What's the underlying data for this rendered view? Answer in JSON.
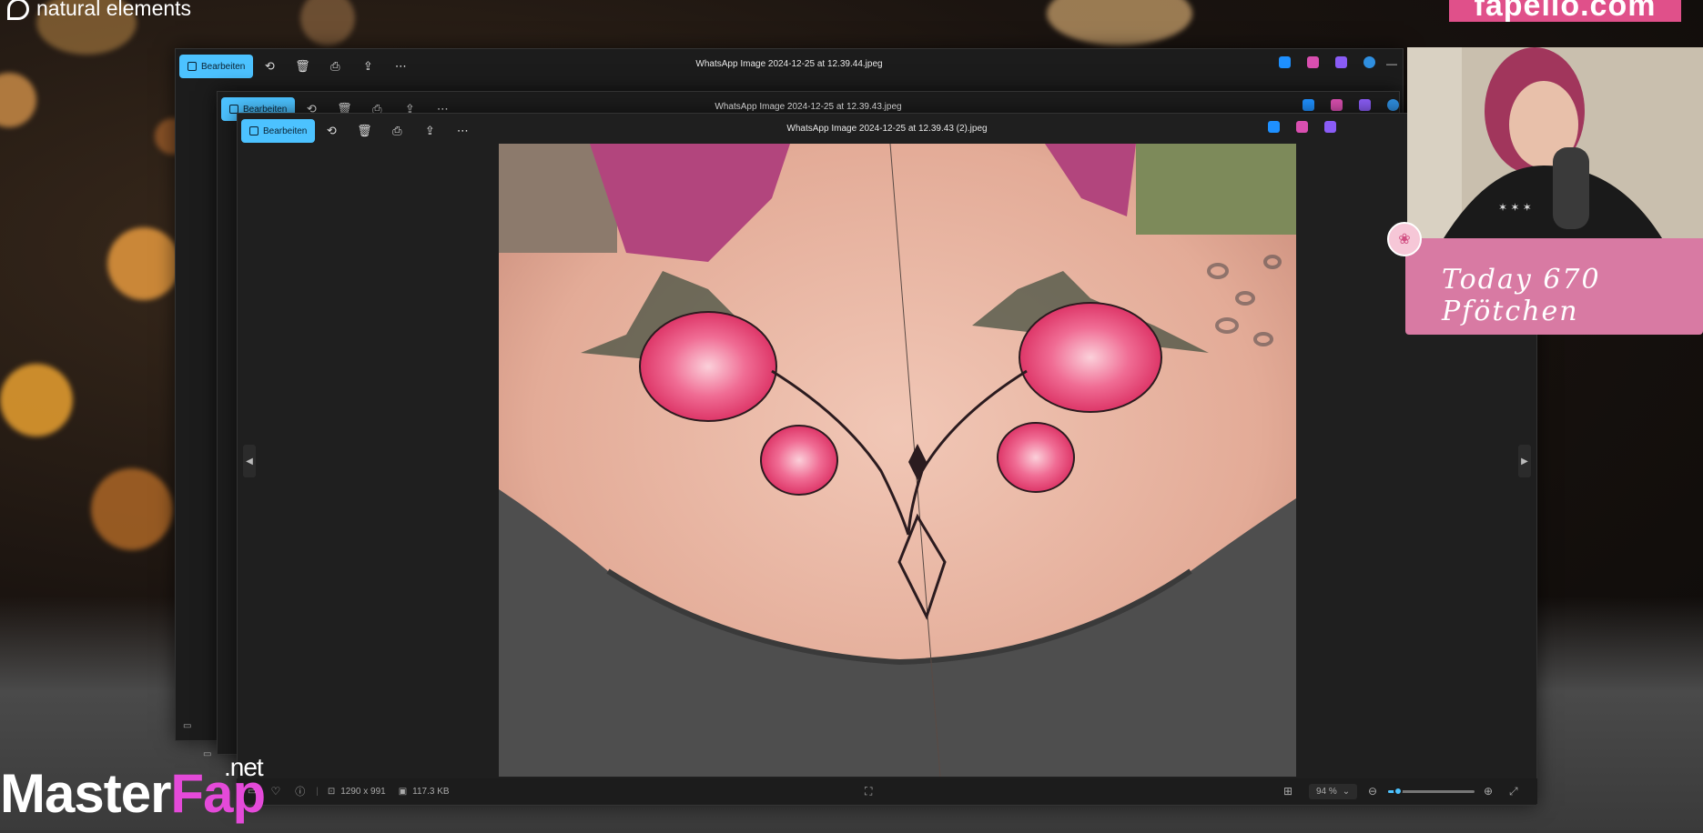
{
  "brand": {
    "text": "natural elements"
  },
  "url_banner": {
    "text": "fapello.com"
  },
  "windows": [
    {
      "title": "WhatsApp Image 2024-12-25 at 12.39.44.jpeg",
      "edit_label": "Bearbeiten"
    },
    {
      "title": "WhatsApp Image 2024-12-25 at 12.39.43.jpeg",
      "edit_label": "Bearbeiten"
    },
    {
      "title": "WhatsApp Image 2024-12-25 at 12.39.43 (2).jpeg",
      "edit_label": "Bearbeiten"
    }
  ],
  "toolbar_icons": [
    "rotate-icon",
    "delete-icon",
    "print-icon",
    "share-icon",
    "more-icon"
  ],
  "status": {
    "dimensions": "1290 x 991",
    "filesize": "117.3 KB",
    "zoom": "94 %",
    "zoom_fraction": 0.12
  },
  "overlay": {
    "cam_text": "Today   670   Pfötchen",
    "watermark_main": "Master",
    "watermark_accent": "Fap",
    "watermark_suffix": ".net"
  },
  "colors": {
    "accent": "#4cc2ff",
    "pink_panel": "#d87aa3",
    "banner": "#e0508a"
  }
}
